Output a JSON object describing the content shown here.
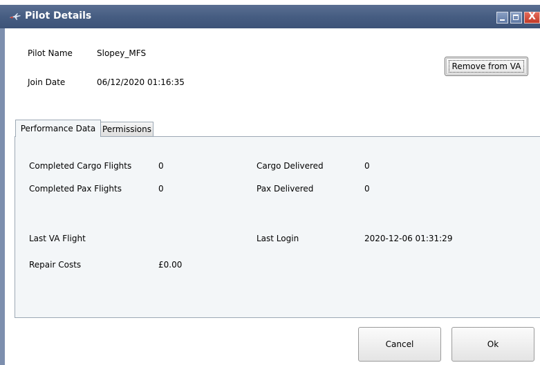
{
  "window": {
    "title": "Pilot Details",
    "controls": {
      "minimize": "",
      "maximize": "",
      "close": "X"
    }
  },
  "header": {
    "pilot_name_label": "Pilot Name",
    "pilot_name_value": "Slopey_MFS",
    "join_date_label": "Join Date",
    "join_date_value": "06/12/2020 01:16:35",
    "remove_button": "Remove from VA"
  },
  "tabs": [
    {
      "label": "Performance Data",
      "active": true
    },
    {
      "label": "Permissions",
      "active": false
    }
  ],
  "performance": {
    "completed_cargo_label": "Completed Cargo Flights",
    "completed_cargo_value": "0",
    "completed_pax_label": "Completed Pax Flights",
    "completed_pax_value": "0",
    "cargo_delivered_label": "Cargo Delivered",
    "cargo_delivered_value": "0",
    "pax_delivered_label": "Pax Delivered",
    "pax_delivered_value": "0",
    "last_va_flight_label": "Last VA Flight",
    "last_va_flight_value": "",
    "last_login_label": "Last Login",
    "last_login_value": "2020-12-06 01:31:29",
    "repair_costs_label": "Repair Costs",
    "repair_costs_value": "£0.00"
  },
  "footer": {
    "cancel_button": "Cancel",
    "ok_button": "Ok"
  },
  "colors": {
    "titlebar": "#465d82",
    "panel_background": "#f3f6f8",
    "close_button": "#c13a28"
  },
  "icons": {
    "title_icon": "plane-icon",
    "minimize": "minimize-icon",
    "maximize": "maximize-icon",
    "close": "close-icon"
  }
}
